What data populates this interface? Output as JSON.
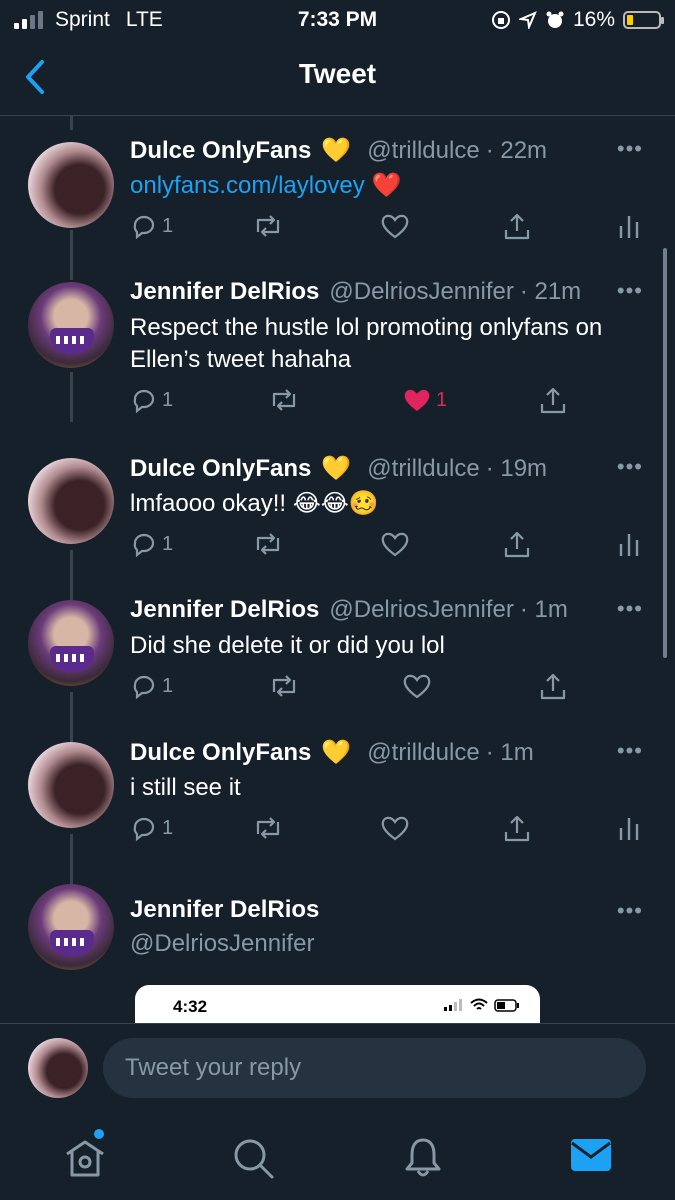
{
  "status_bar": {
    "carrier": "Sprint",
    "network": "LTE",
    "time": "7:33 PM",
    "battery": "16%"
  },
  "nav": {
    "title": "Tweet"
  },
  "tweets": [
    {
      "name": "Dulce OnlyFans",
      "emoji": "💛",
      "handle": "@trilldulce",
      "time": "· 22m",
      "text": "",
      "link": "onlyfans.com/laylovey",
      "link_emoji": "❤️",
      "replies": "1",
      "retweets": "",
      "likes": "",
      "liked": false,
      "more": "•••"
    },
    {
      "name": "Jennifer DelRios",
      "emoji": "",
      "handle": "@DelriosJennifer",
      "time": "· 21m",
      "text": "Respect the hustle lol promoting onlyfans on Ellen’s tweet hahaha",
      "replies": "1",
      "retweets": "",
      "likes": "1",
      "liked": true,
      "more": "•••"
    },
    {
      "name": "Dulce OnlyFans",
      "emoji": "💛",
      "handle": "@trilldulce",
      "time": "· 19m",
      "text": "lmfaooo okay!! 😂😂🥴",
      "replies": "1",
      "retweets": "",
      "likes": "",
      "liked": false,
      "more": "•••"
    },
    {
      "name": "Jennifer DelRios",
      "emoji": "",
      "handle": "@DelriosJennifer",
      "time": "· 1m",
      "text": "Did she delete it or did you lol",
      "replies": "1",
      "retweets": "",
      "likes": "",
      "liked": false,
      "more": "•••"
    },
    {
      "name": "Dulce OnlyFans",
      "emoji": "💛",
      "handle": "@trilldulce",
      "time": "· 1m",
      "text": "i still see it",
      "replies": "1",
      "retweets": "",
      "likes": "",
      "liked": false,
      "more": "•••"
    }
  ],
  "main_tweet": {
    "name": "Jennifer DelRios",
    "handle": "@DelriosJennifer",
    "more": "•••",
    "image_preview": {
      "time": "4:32"
    }
  },
  "reply": {
    "placeholder": "Tweet your reply"
  },
  "tabs": [
    "home-icon",
    "search-icon",
    "bell-icon",
    "mail-icon"
  ],
  "colors": {
    "background": "#15202b",
    "accent": "#1da1f2",
    "like": "#e0245e",
    "muted": "#8899a6"
  }
}
